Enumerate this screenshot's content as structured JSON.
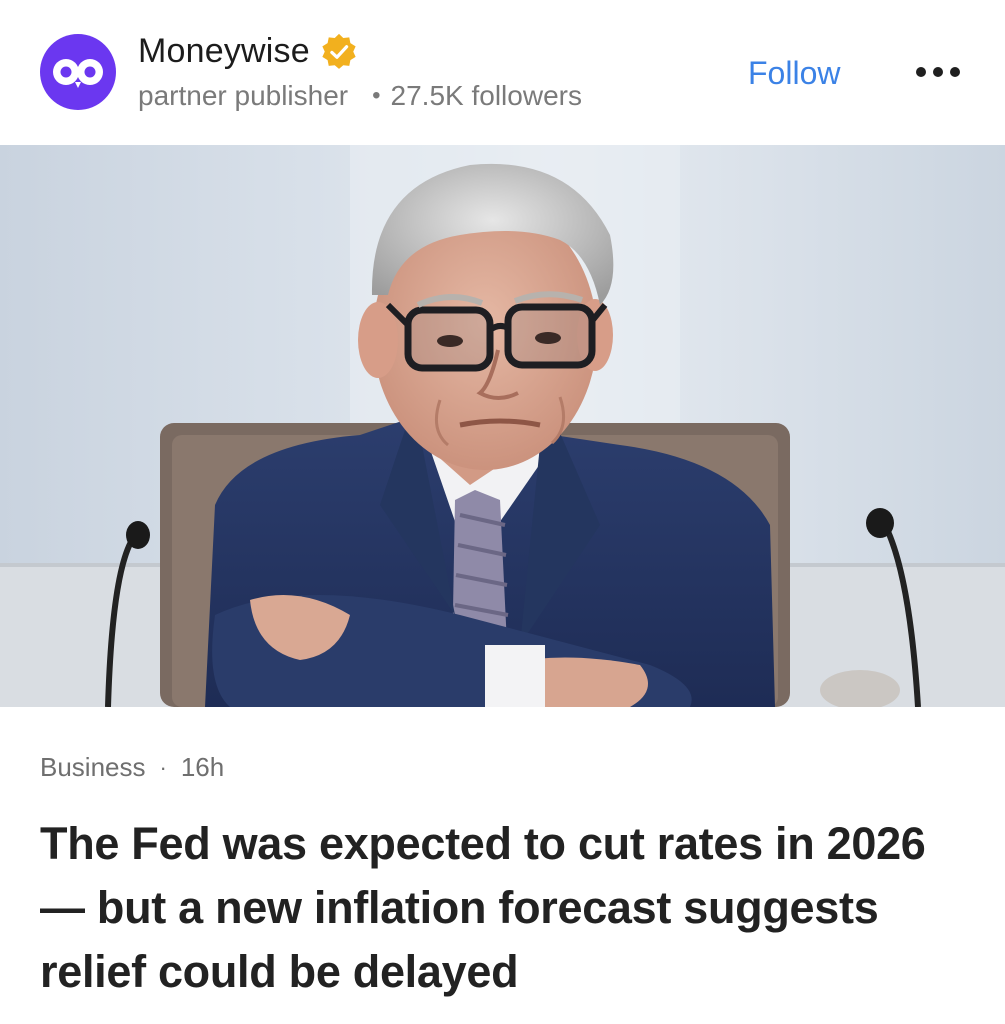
{
  "publisher": {
    "name": "Moneywise",
    "avatar_icon": "owl-eyes-logo",
    "verified_icon": "verified-badge-icon",
    "type": "partner publisher",
    "followers": "27.5K followers",
    "brand_color": "#6b37f0",
    "badge_color": "#f2b01e"
  },
  "header": {
    "follow_label": "Follow",
    "follow_color": "#3b82e6",
    "more_icon": "more-dots-icon"
  },
  "hero": {
    "image_subject": "photo"
  },
  "article": {
    "category": "Business",
    "age": "16h",
    "headline": "The Fed was expected to cut rates in 2026 — but a new inflation forecast suggests relief could be delayed"
  }
}
